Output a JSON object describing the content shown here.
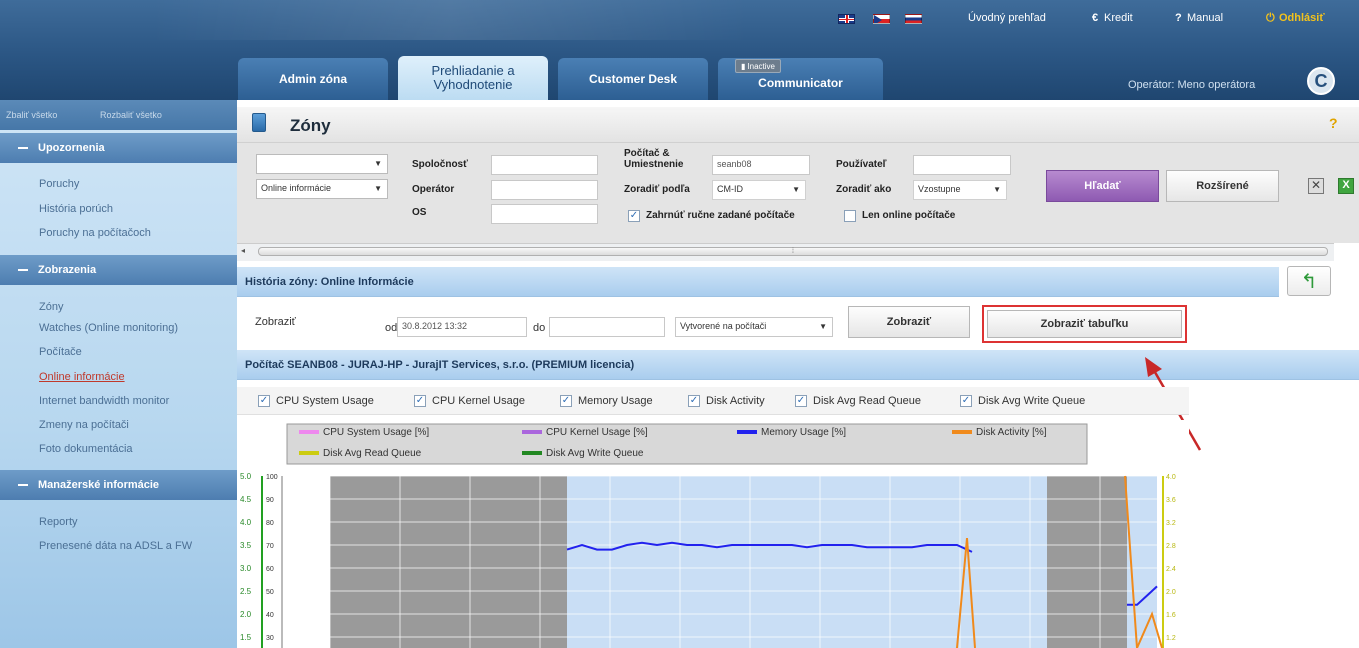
{
  "topnav": {
    "overview": "Úvodný prehľad",
    "credit": "Kredit",
    "manual": "Manual",
    "logout": "Odhlásiť",
    "operator": "Operátor: Meno operátora"
  },
  "tabs": [
    {
      "label": "Admin zóna"
    },
    {
      "label_line1": "Prehliadanie a",
      "label_line2": "Vyhodnotenie"
    },
    {
      "label": "Customer Desk"
    },
    {
      "label": "Communicator",
      "badge": "Inactive"
    }
  ],
  "sidebar": {
    "collapse_all": "Zbaliť všetko",
    "expand_all": "Rozbaliť všetko",
    "sections": [
      {
        "title": "Upozornenia",
        "items": [
          "Poruchy",
          "História porúch",
          "Poruchy na počítačoch"
        ]
      },
      {
        "title": "Zobrazenia",
        "items": [
          "Zóny",
          "Watches (Online monitoring)",
          "Počítače",
          "Online informácie",
          "Internet bandwidth monitor",
          "Zmeny na počítači",
          "Foto dokumentácia"
        ]
      },
      {
        "title": "Manažerské informácie",
        "items": [
          "Reporty",
          "Prenesené dáta na ADSL a FW"
        ]
      }
    ]
  },
  "page": {
    "title": "Zóny",
    "help": "?"
  },
  "filters": {
    "select1": "",
    "select2": "Online informácie",
    "spolocnost_label": "Spoločnosť",
    "operator_label": "Operátor",
    "os_label": "OS",
    "pocitac_label_line1": "Počítač &",
    "pocitac_label_line2": "Umiestnenie",
    "pocitac_value": "seanb08",
    "zoradit_podla_label": "Zoradiť podľa",
    "zoradit_podla_value": "CM-ID",
    "pouzivatel_label": "Používateľ",
    "zoradit_ako_label": "Zoradiť ako",
    "zoradit_ako_value": "Vzostupne",
    "chk_manual": "Zahrnúť ručne zadané počítače",
    "chk_online": "Len online počítače",
    "search_btn": "Hľadať",
    "advanced_btn": "Rozšírené"
  },
  "history": {
    "title": "História zóny: Online Informácie",
    "show_label": "Zobraziť",
    "from_label": "od",
    "from_value": "30.8.2012 13:32",
    "to_label": "do",
    "created_select": "Vytvorené na počítači",
    "show_btn": "Zobraziť",
    "show_table_btn": "Zobraziť tabuľku"
  },
  "computer_bar": "Počítač SEANB08 - JURAJ-HP - JurajIT Services, s.r.o. (PREMIUM licencia)",
  "metric_checkboxes": [
    "CPU System Usage",
    "CPU Kernel Usage",
    "Memory Usage",
    "Disk Activity",
    "Disk Avg Read Queue",
    "Disk Avg Write Queue"
  ],
  "colors": {
    "cpu_system": "#ee88ee",
    "cpu_kernel": "#aa66dd",
    "memory": "#2222ee",
    "disk_activity": "#f08a1c",
    "disk_read": "#cccc11",
    "disk_write": "#228822"
  },
  "chart_data": {
    "type": "line",
    "legend": [
      "CPU System Usage [%]",
      "CPU Kernel Usage [%]",
      "Memory Usage [%]",
      "Disk Activity [%]",
      "Disk Avg Read Queue",
      "Disk Avg Write Queue"
    ],
    "y_left_outer_ticks": [
      "5.0",
      "4.5",
      "4.0",
      "3.5",
      "3.0",
      "2.5",
      "2.0",
      "1.5"
    ],
    "y_left_inner_ticks": [
      "100",
      "90",
      "80",
      "70",
      "60",
      "50",
      "40",
      "30"
    ],
    "y_right_ticks": [
      "4.0",
      "3.6",
      "3.2",
      "2.8",
      "2.4",
      "2.0",
      "1.6",
      "1.2"
    ],
    "series": [
      {
        "name": "Memory Usage [%]",
        "values": [
          68,
          70,
          68,
          68,
          70,
          71,
          70,
          71,
          70,
          70,
          69,
          70,
          70,
          70,
          70,
          70,
          69,
          70,
          70,
          70,
          69,
          69,
          69,
          69,
          70,
          70,
          70,
          67
        ]
      },
      {
        "name": "Disk Activity [%]",
        "values": [
          20,
          73,
          10
        ]
      }
    ]
  }
}
